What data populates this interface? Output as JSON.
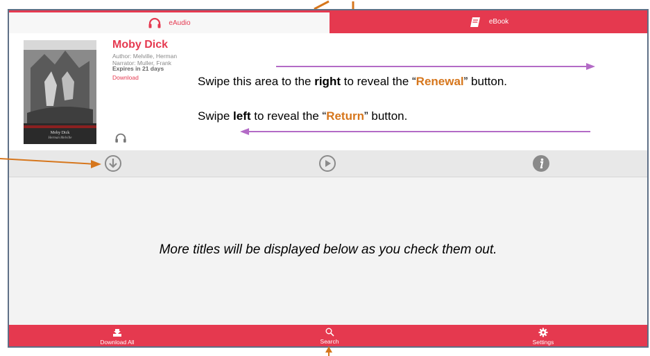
{
  "tabs": {
    "eaudio": "eAudio",
    "ebook": "eBook"
  },
  "item": {
    "title": "Moby Dick",
    "author": "Author: Melville, Herman",
    "narrator": "Narrator: Muller, Frank",
    "expires": "Expires in 21 days",
    "download": "Download",
    "cover_title": "Moby Dick",
    "cover_author": "Herman Melville"
  },
  "instructions": {
    "right_prefix": "Swipe this area to the ",
    "right_word": "right",
    "right_mid": " to reveal the “",
    "renewal": "Renewal",
    "right_suffix": "” button.",
    "left_prefix": "Swipe ",
    "left_word": "left",
    "left_mid": " to reveal the “",
    "return": "Return",
    "left_suffix": "” button."
  },
  "more_titles": "More titles will be displayed below as you check them out.",
  "bottom_bar": {
    "download_all": "Download All",
    "search": "Search",
    "settings": "Settings"
  },
  "colors": {
    "accent": "#e5394f",
    "highlight": "#d6761c",
    "arrow": "#b36ac6",
    "frame": "#5e6f86"
  }
}
